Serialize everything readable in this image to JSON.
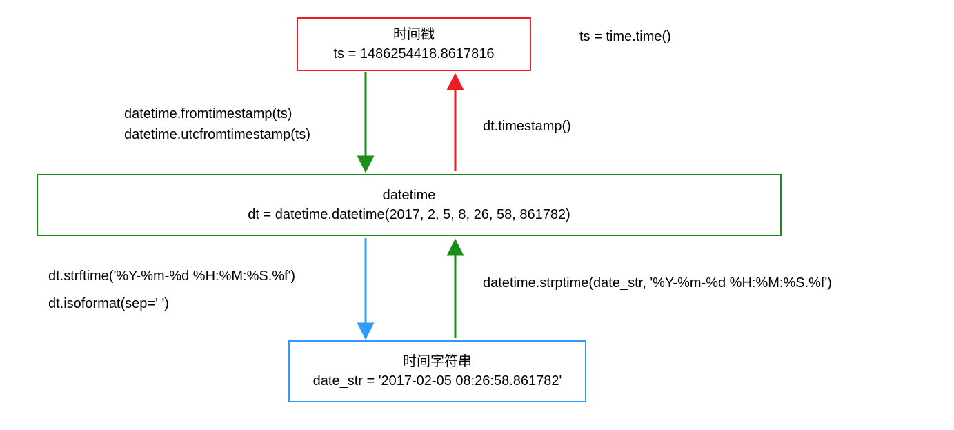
{
  "nodes": {
    "timestamp": {
      "title": "时间戳",
      "value": "ts = 1486254418.8617816"
    },
    "datetime": {
      "title": "datetime",
      "value": "dt = datetime.datetime(2017, 2, 5, 8, 26, 58, 861782)"
    },
    "datestring": {
      "title": "时间字符串",
      "value": "date_str = '2017-02-05 08:26:58.861782'"
    }
  },
  "labels": {
    "ts_source": "ts = time.time()",
    "ts_to_dt_1": "datetime.fromtimestamp(ts)",
    "ts_to_dt_2": "datetime.utcfromtimestamp(ts)",
    "dt_to_ts": "dt.timestamp()",
    "dt_to_str_1": "dt.strftime('%Y-%m-%d %H:%M:%S.%f')",
    "dt_to_str_2": "dt.isoformat(sep=' ')",
    "str_to_dt": "datetime.strptime(date_str, '%Y-%m-%d %H:%M:%S.%f')"
  },
  "colors": {
    "red": "#ed1c24",
    "green": "#1a8d1a",
    "blue": "#2f9bff"
  }
}
